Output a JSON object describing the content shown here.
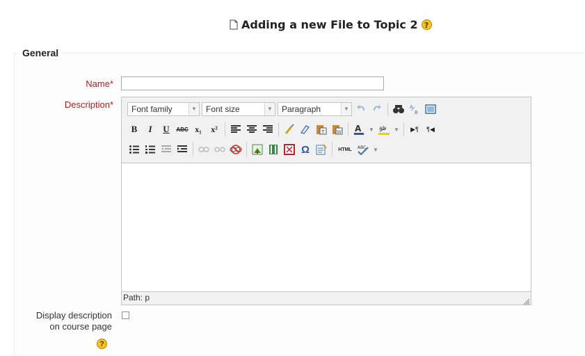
{
  "heading": {
    "title": "Adding a new File to Topic 2"
  },
  "section": {
    "legend": "General"
  },
  "fields": {
    "name_label": "Name",
    "required_mark": "*",
    "name_value": "",
    "description_label": "Description"
  },
  "editor": {
    "font_family": "Font family",
    "font_size": "Font size",
    "format": "Paragraph",
    "path_label": "Path: p",
    "toolbar": {
      "bold": "B",
      "italic": "I",
      "underline": "U",
      "strike": "ABC",
      "subscript": "x₁",
      "superscript": "x²",
      "html": "HTML",
      "ltr": "▶¶",
      "rtl": "¶◀",
      "omega": "Ω"
    }
  },
  "display_option": {
    "label_line1": "Display description",
    "label_line2": "on course page"
  },
  "help": {
    "symbol": "?"
  },
  "colors": {
    "required": "#a52424",
    "help": "#f6c324"
  }
}
